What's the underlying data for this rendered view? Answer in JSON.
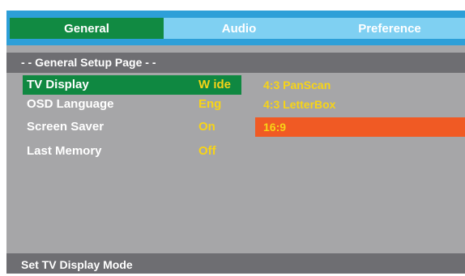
{
  "tabs": [
    {
      "label": "General",
      "active": true
    },
    {
      "label": "Audio",
      "active": false
    },
    {
      "label": "Preference",
      "active": false
    }
  ],
  "page_title": "- - General Setup Page - -",
  "settings": [
    {
      "label": "TV Display",
      "value": "W ide",
      "selected": true
    },
    {
      "label": "OSD Language",
      "value": "Eng",
      "selected": false
    },
    {
      "label": "Screen Saver",
      "value": "On",
      "selected": false
    },
    {
      "label": "Last Memory",
      "value": "Off",
      "selected": false
    }
  ],
  "options": [
    {
      "label": "4:3 PanScan",
      "highlighted": false
    },
    {
      "label": "4:3 LetterBox",
      "highlighted": false
    },
    {
      "label": "16:9",
      "highlighted": true
    }
  ],
  "status_text": "Set TV Display Mode",
  "colors": {
    "tab_bar": "#2d9fd8",
    "tab_active": "#118a42",
    "tab_inactive": "#7fd0f2",
    "panel": "#a6a6a8",
    "header": "#6e6e72",
    "value_text": "#f7d417",
    "option_highlight": "#f05a24"
  }
}
